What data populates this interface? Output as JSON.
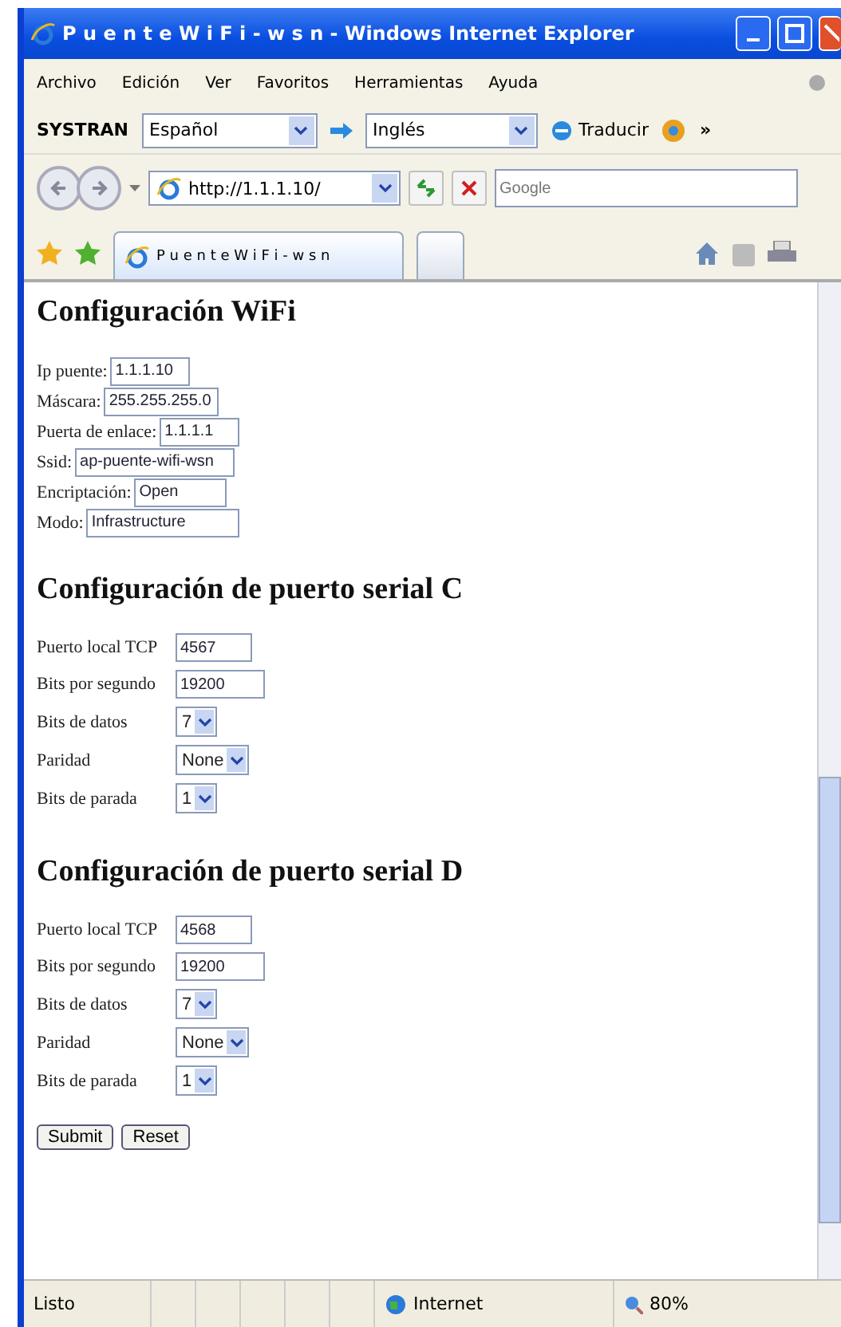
{
  "window": {
    "title": "P u e n t e W i F i - w s n - Windows Internet Explorer"
  },
  "menu": [
    "Archivo",
    "Edición",
    "Ver",
    "Favoritos",
    "Herramientas",
    "Ayuda"
  ],
  "translate_bar": {
    "brand": "SYSTRAN",
    "from": "Español",
    "to": "Inglés",
    "button": "Traducir",
    "more": "»"
  },
  "address_bar": {
    "url": "http://1.1.1.10/",
    "search_placeholder": "Google"
  },
  "tabs": [
    {
      "label": "P u e n t e W i F i - w s n",
      "selected": true
    },
    {
      "selected": false
    }
  ],
  "sections": [
    {
      "kind": "inline",
      "title": "Configuración WiFi",
      "fields": [
        {
          "label": "Ip puente:",
          "value": "1.1.1.10",
          "kind": "text"
        },
        {
          "label": "Máscara:",
          "value": "255.255.255.0",
          "kind": "text"
        },
        {
          "label": "Puerta de enlace:",
          "value": "1.1.1.1",
          "kind": "text"
        },
        {
          "label": "Ssid:",
          "value": "ap-puente-wifi-wsn",
          "kind": "text"
        },
        {
          "label": "Encriptación:",
          "value": "Open",
          "kind": "text"
        },
        {
          "label": "Modo:",
          "value": "Infrastructure",
          "kind": "text"
        }
      ]
    },
    {
      "kind": "table",
      "title": "Configuración de puerto serial C",
      "fields": [
        {
          "label": "Puerto local TCP",
          "value": "4567",
          "kind": "text"
        },
        {
          "label": "Bits por segundo",
          "value": "19200",
          "kind": "text"
        },
        {
          "label": "Bits de datos",
          "value": "7",
          "kind": "select"
        },
        {
          "label": "Paridad",
          "value": "None",
          "kind": "select"
        },
        {
          "label": "Bits de parada",
          "value": "1",
          "kind": "select"
        }
      ]
    },
    {
      "kind": "table",
      "title": "Configuración de puerto serial D",
      "fields": [
        {
          "label": "Puerto local TCP",
          "value": "4568",
          "kind": "text"
        },
        {
          "label": "Bits por segundo",
          "value": "19200",
          "kind": "text"
        },
        {
          "label": "Bits de datos",
          "value": "7",
          "kind": "select"
        },
        {
          "label": "Paridad",
          "value": "None",
          "kind": "select"
        },
        {
          "label": "Bits de parada",
          "value": "1",
          "kind": "select"
        }
      ]
    }
  ],
  "form_buttons": [
    "Submit",
    "Reset"
  ],
  "status_bar": {
    "text": "Listo",
    "zone": "Internet",
    "zoom": "80%"
  }
}
